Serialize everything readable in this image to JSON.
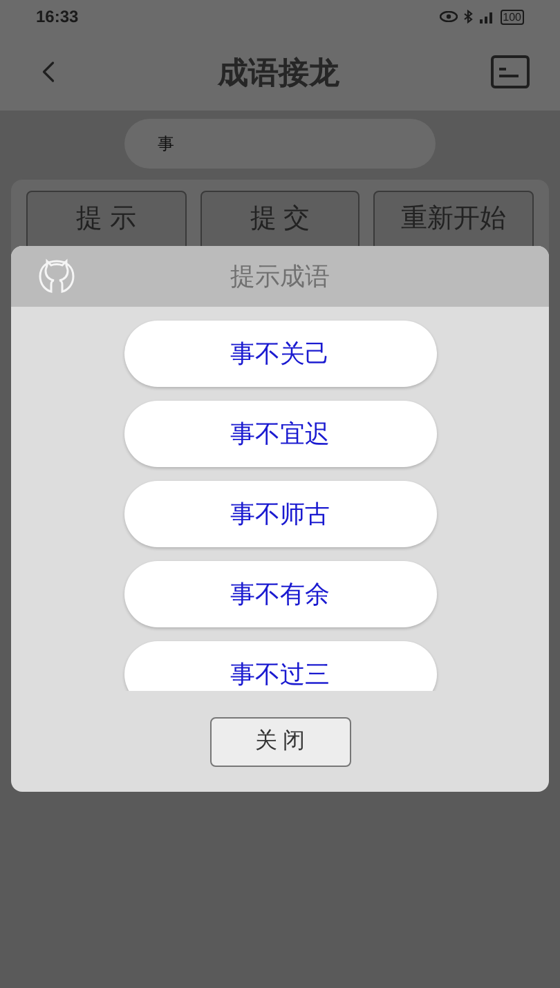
{
  "status_bar": {
    "time": "16:33",
    "battery": "100"
  },
  "header": {
    "title": "成语接龙"
  },
  "input": {
    "value": "事"
  },
  "buttons": [
    "提 示",
    "提 交",
    "重新开始"
  ],
  "dialog": {
    "title": "提示成语",
    "idioms": [
      "事不关己",
      "事不宜迟",
      "事不师古",
      "事不有余",
      "事不过三"
    ],
    "close": "关 闭"
  }
}
